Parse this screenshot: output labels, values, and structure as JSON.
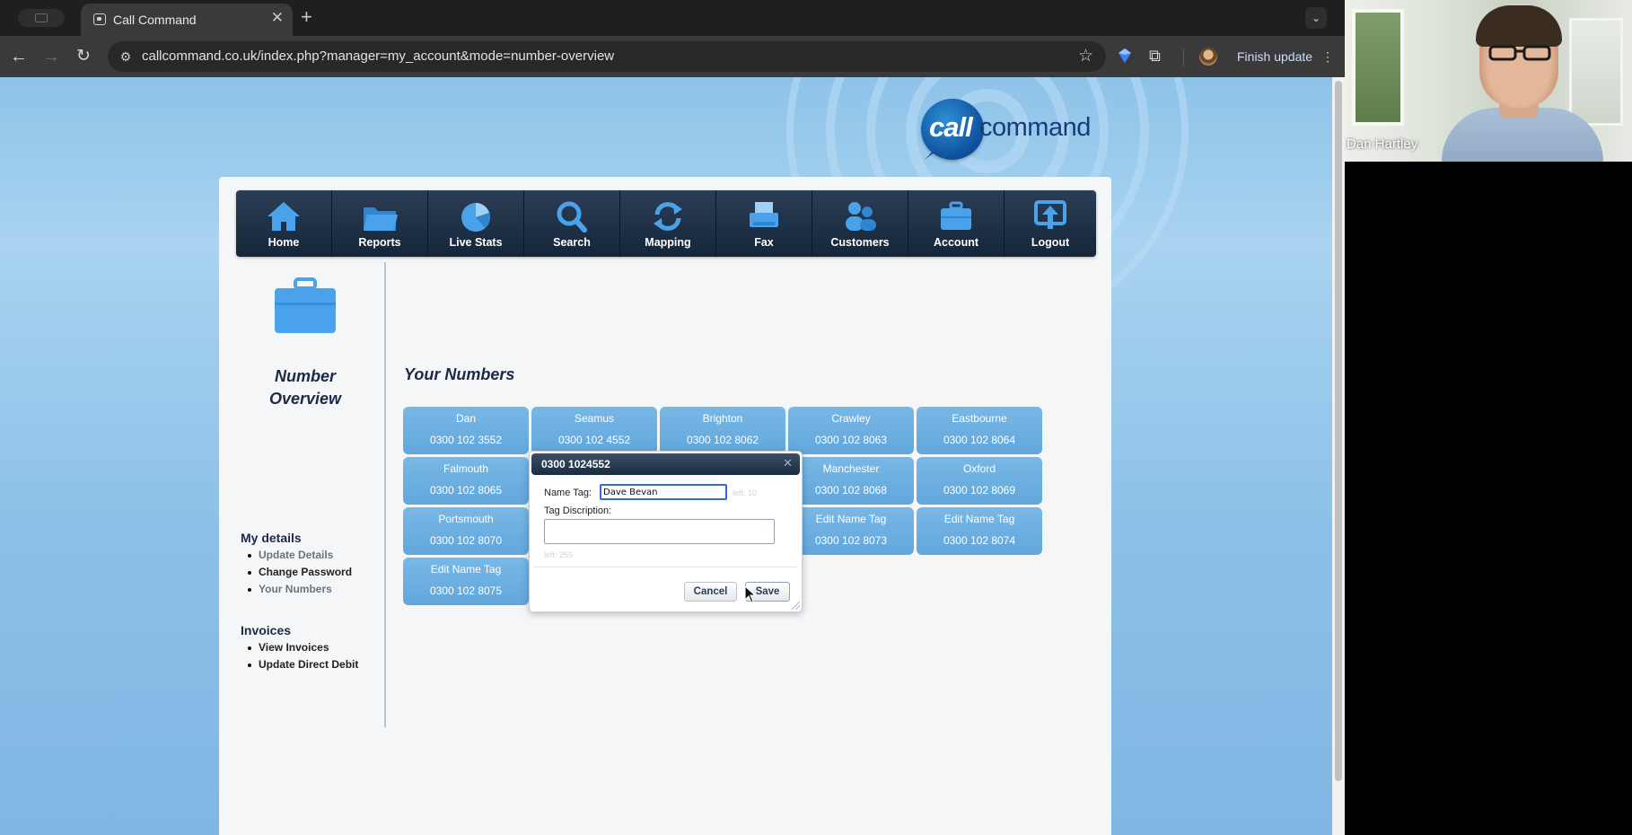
{
  "browser": {
    "tab_title": "Call Command",
    "url": "callcommand.co.uk/index.php?manager=my_account&mode=number-overview",
    "finish_update_label": "Finish update"
  },
  "logo": {
    "part1": "call",
    "part2": "command"
  },
  "nav": [
    {
      "label": "Home",
      "icon": "home-icon"
    },
    {
      "label": "Reports",
      "icon": "folder-icon"
    },
    {
      "label": "Live Stats",
      "icon": "pie-chart-icon"
    },
    {
      "label": "Search",
      "icon": "magnifier-icon"
    },
    {
      "label": "Mapping",
      "icon": "refresh-icon"
    },
    {
      "label": "Fax",
      "icon": "fax-icon"
    },
    {
      "label": "Customers",
      "icon": "people-icon"
    },
    {
      "label": "Account",
      "icon": "briefcase-icon"
    },
    {
      "label": "Logout",
      "icon": "upload-icon"
    }
  ],
  "sidebar": {
    "title_line1": "Number",
    "title_line2": "Overview",
    "my_details": {
      "heading": "My details",
      "items": [
        "Update Details",
        "Change Password",
        "Your Numbers"
      ]
    },
    "invoices": {
      "heading": "Invoices",
      "items": [
        "View Invoices",
        "Update Direct Debit"
      ]
    }
  },
  "main": {
    "heading": "Your Numbers",
    "numbers": [
      {
        "tag": "Dan",
        "number": "0300 102 3552"
      },
      {
        "tag": "Seamus",
        "number": "0300 102 4552"
      },
      {
        "tag": "Brighton",
        "number": "0300 102 8062"
      },
      {
        "tag": "Crawley",
        "number": "0300 102 8063"
      },
      {
        "tag": "Eastbourne",
        "number": "0300 102 8064"
      },
      {
        "tag": "Falmouth",
        "number": "0300 102 8065"
      },
      {
        "tag": "",
        "number": ""
      },
      {
        "tag": "",
        "number": ""
      },
      {
        "tag": "Manchester",
        "number": "0300 102 8068"
      },
      {
        "tag": "Oxford",
        "number": "0300 102 8069"
      },
      {
        "tag": "Portsmouth",
        "number": "0300 102 8070"
      },
      {
        "tag": "",
        "number": ""
      },
      {
        "tag": "",
        "number": ""
      },
      {
        "tag": "Edit Name Tag",
        "number": "0300 102 8073"
      },
      {
        "tag": "Edit Name Tag",
        "number": "0300 102 8074"
      },
      {
        "tag": "Edit Name Tag",
        "number": "0300 102 8075"
      }
    ]
  },
  "dialog": {
    "title": "0300 1024552",
    "name_label": "Name Tag:",
    "name_value": "Dave Bevan",
    "name_left": "left: 10",
    "desc_label": "Tag Discription:",
    "desc_left": "left: 255",
    "cancel_label": "Cancel",
    "save_label": "Save"
  },
  "video": {
    "participant_name": "Dan Hartley"
  },
  "colors": {
    "nav_bg": "#1b2c40",
    "tile_bg": "#6aaee0",
    "page_bg": "#8ec3e8",
    "heading": "#1c2a48"
  }
}
